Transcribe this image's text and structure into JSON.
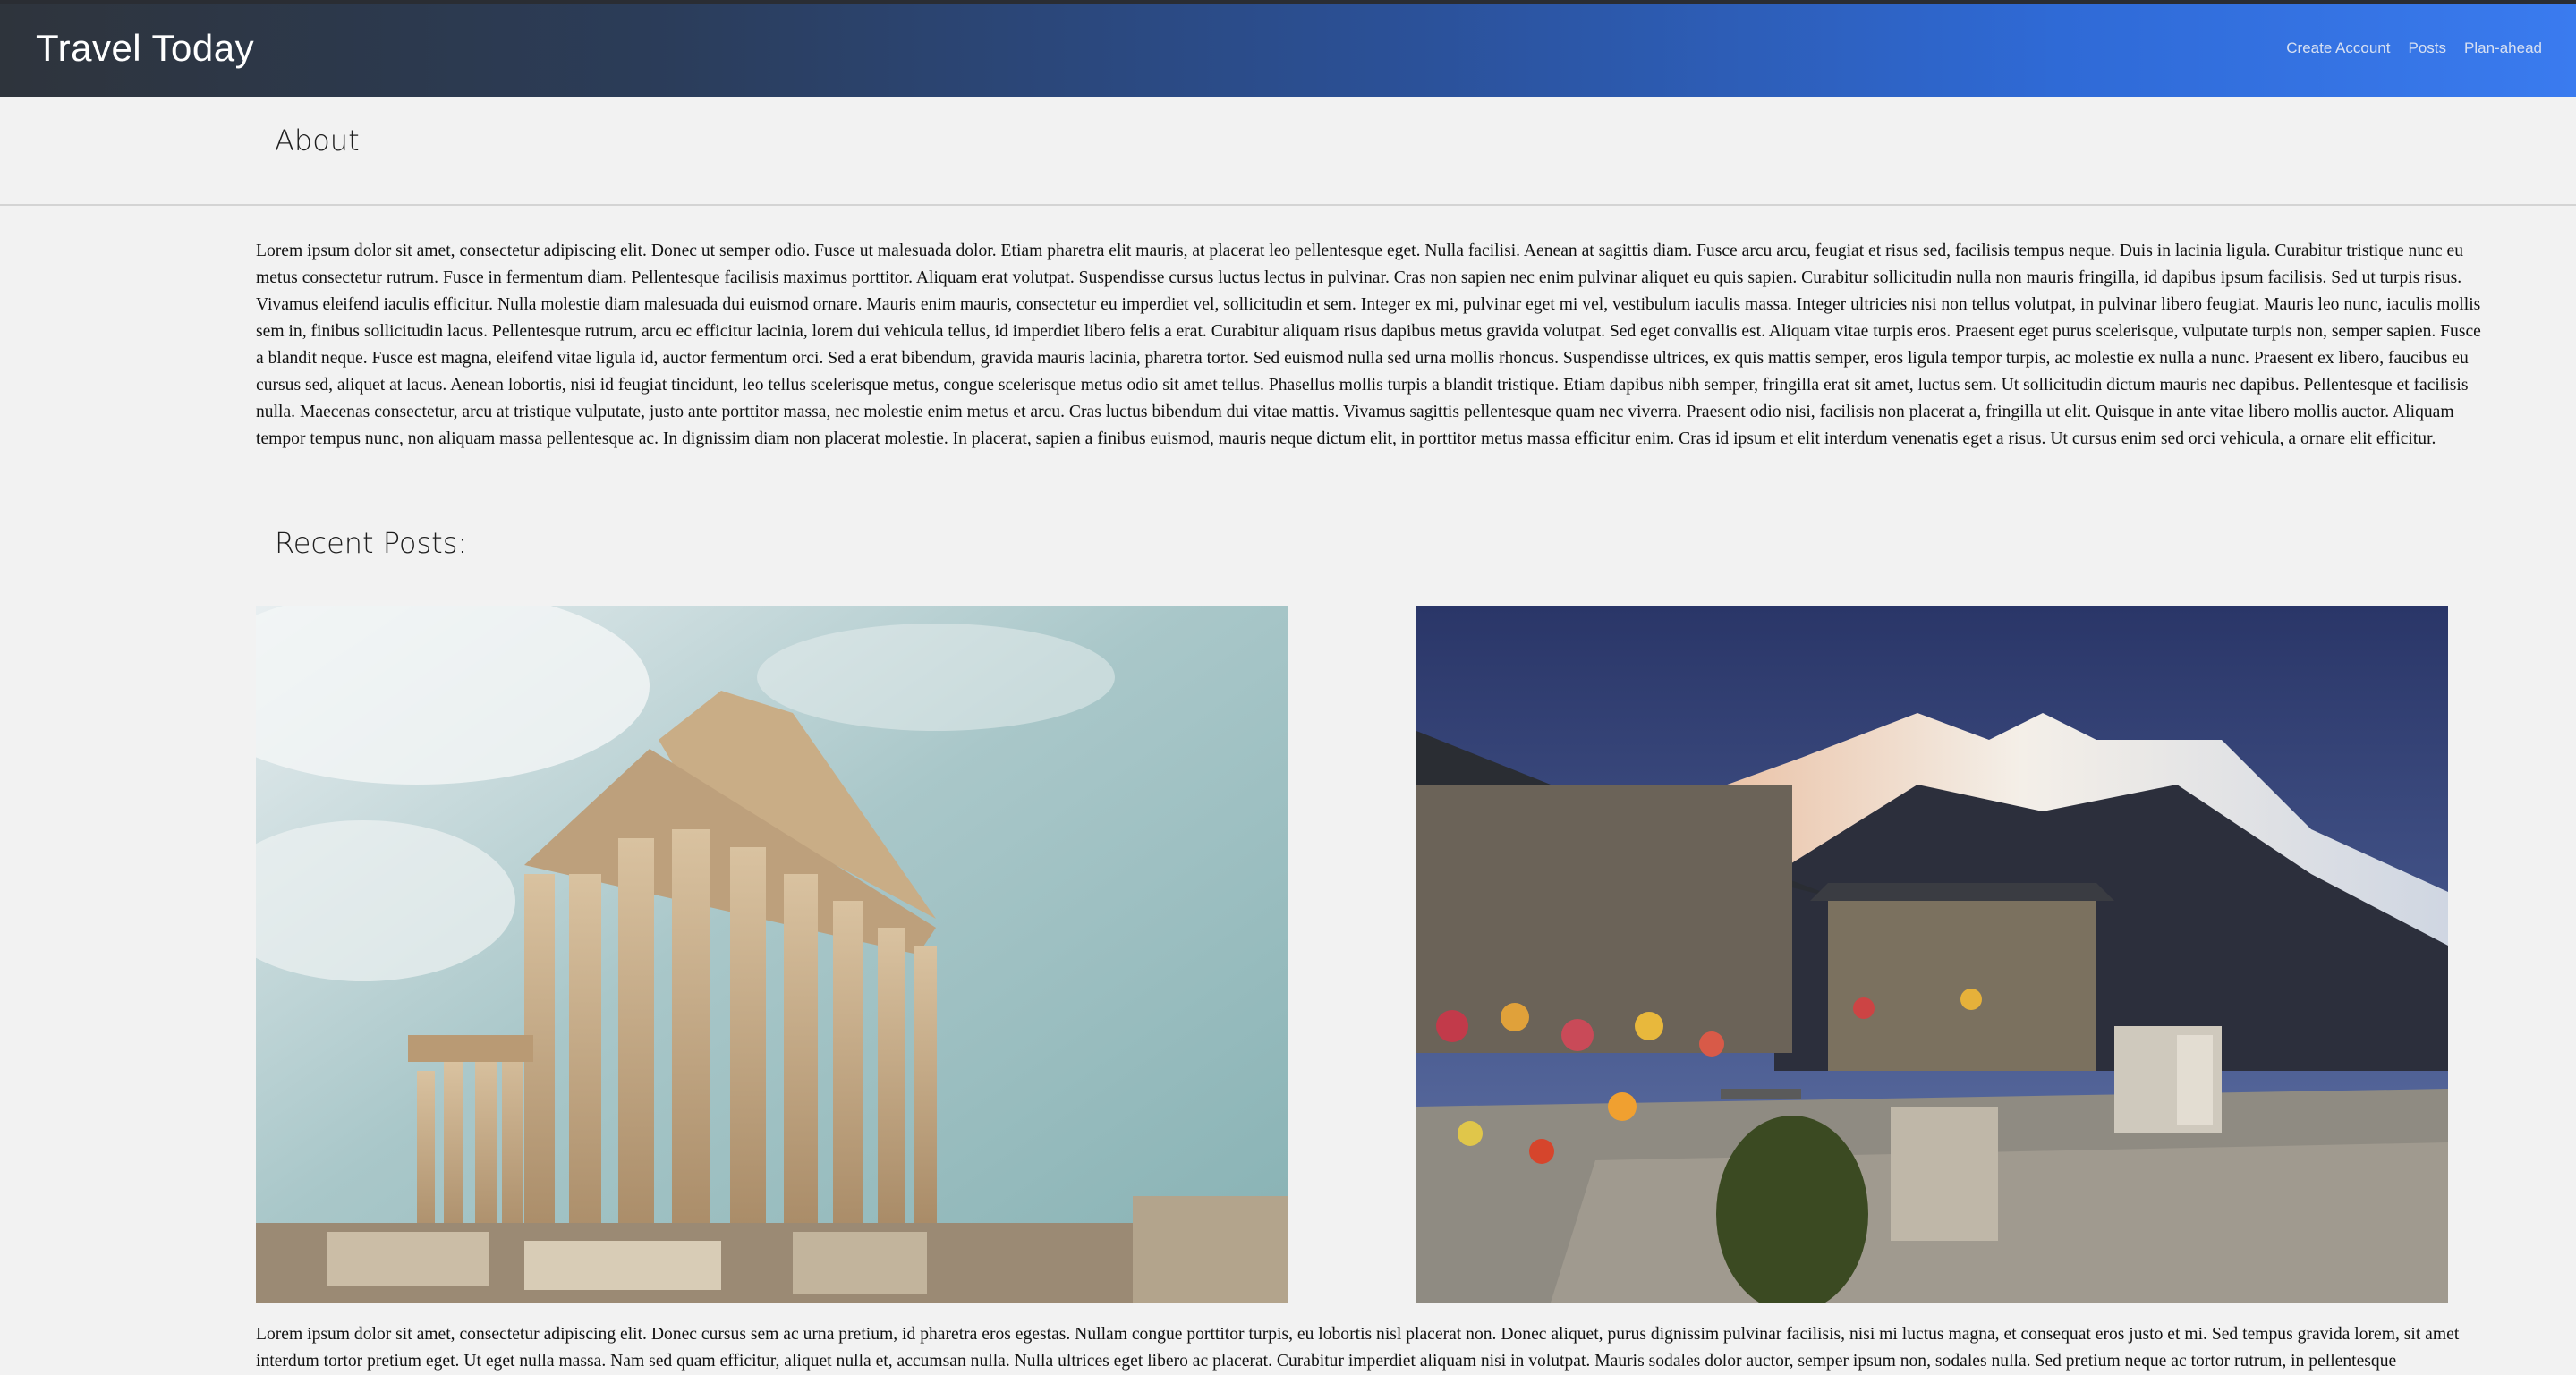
{
  "navbar": {
    "brand": "Travel Today",
    "links": [
      "Create Account",
      "Posts",
      "Plan-ahead"
    ]
  },
  "about": {
    "heading": "About",
    "text": "Lorem ipsum dolor sit amet, consectetur adipiscing elit. Donec ut semper odio. Fusce ut malesuada dolor. Etiam pharetra elit mauris, at placerat leo pellentesque eget. Nulla facilisi. Aenean at sagittis diam. Fusce arcu arcu, feugiat et risus sed, facilisis tempus neque. Duis in lacinia ligula. Curabitur tristique nunc eu metus consectetur rutrum. Fusce in fermentum diam. Pellentesque facilisis maximus porttitor. Aliquam erat volutpat. Suspendisse cursus luctus lectus in pulvinar. Cras non sapien nec enim pulvinar aliquet eu quis sapien. Curabitur sollicitudin nulla non mauris fringilla, id dapibus ipsum facilisis. Sed ut turpis risus. Vivamus eleifend iaculis efficitur. Nulla molestie diam malesuada dui euismod ornare. Mauris enim mauris, consectetur eu imperdiet vel, sollicitudin et sem. Integer ex mi, pulvinar eget mi vel, vestibulum iaculis massa. Integer ultricies nisi non tellus volutpat, in pulvinar libero feugiat. Mauris leo nunc, iaculis mollis sem in, finibus sollicitudin lacus. Pellentesque rutrum, arcu ec efficitur lacinia, lorem dui vehicula tellus, id imperdiet libero felis a erat. Curabitur aliquam risus dapibus metus gravida volutpat. Sed eget convallis est. Aliquam vitae turpis eros. Praesent eget purus scelerisque, vulputate turpis non, semper sapien. Fusce a blandit neque. Fusce est magna, eleifend vitae ligula id, auctor fermentum orci. Sed a erat bibendum, gravida mauris lacinia, pharetra tortor. Sed euismod nulla sed urna mollis rhoncus. Suspendisse ultrices, ex quis mattis semper, eros ligula tempor turpis, ac molestie ex nulla a nunc. Praesent ex libero, faucibus eu cursus sed, aliquet at lacus. Aenean lobortis, nisi id feugiat tincidunt, leo tellus scelerisque metus, congue scelerisque metus odio sit amet tellus. Phasellus mollis turpis a blandit tristique. Etiam dapibus nibh semper, fringilla erat sit amet, luctus sem. Ut sollicitudin dictum mauris nec dapibus. Pellentesque et facilisis nulla. Maecenas consectetur, arcu at tristique vulputate, justo ante porttitor massa, nec molestie enim metus et arcu. Cras luctus bibendum dui vitae mattis. Vivamus sagittis pellentesque quam nec viverra. Praesent odio nisi, facilisis non placerat a, fringilla ut elit. Quisque in ante vitae libero mollis auctor. Aliquam tempor tempus nunc, non aliquam massa pellentesque ac. In dignissim diam non placerat molestie. In placerat, sapien a finibus euismod, mauris neque dictum elit, in porttitor metus massa efficitur enim. Cras id ipsum et elit interdum venenatis eget a risus. Ut cursus enim sed orci vehicula, a ornare elit efficitur."
  },
  "recent": {
    "heading": "Recent Posts:",
    "post_text": "Lorem ipsum dolor sit amet, consectetur adipiscing elit. Donec cursus sem ac urna pretium, id pharetra eros egestas. Nullam congue porttitor turpis, eu lobortis nisl placerat non. Donec aliquet, purus dignissim pulvinar facilisis, nisi mi luctus magna, et consequat eros justo et mi. Sed tempus gravida lorem, sit amet interdum tortor pretium eget. Ut eget nulla massa. Nam sed quam efficitur, aliquet nulla et, accumsan nulla. Nulla ultrices eget libero ac placerat. Curabitur imperdiet aliquam nisi in volutpat. Mauris sodales dolor auctor, semper ipsum non, sodales nulla. Sed pretium neque ac tortor rutrum, in pellentesque"
  },
  "colors": {
    "page_background": "#f2f2f2",
    "navbar_gradient_start": "#2e343c",
    "navbar_gradient_end": "#3a7bef",
    "text": "#111111"
  }
}
